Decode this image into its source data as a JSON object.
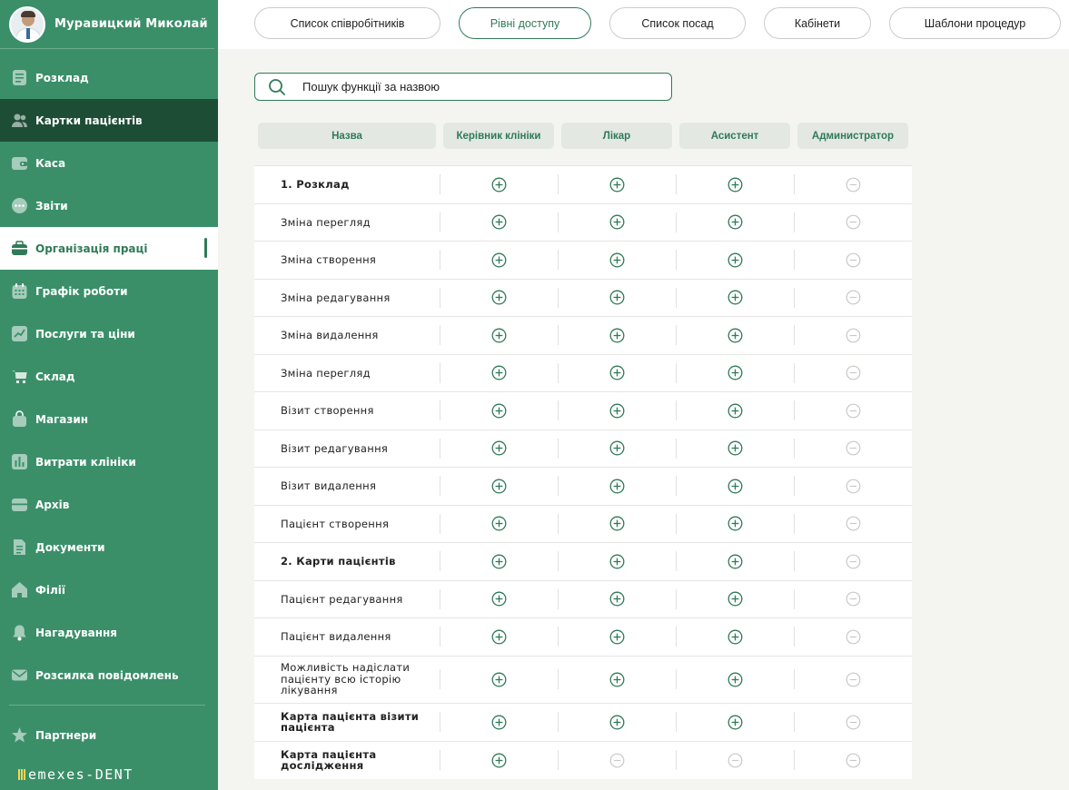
{
  "user": {
    "name": "Муравицкий Миколай"
  },
  "sidebar": {
    "items": [
      {
        "label": "Розклад",
        "icon": "schedule-icon",
        "state": "normal"
      },
      {
        "label": "Картки пацієнтів",
        "icon": "patients-icon",
        "state": "dark"
      },
      {
        "label": "Каса",
        "icon": "wallet-icon",
        "state": "normal"
      },
      {
        "label": "Звіти",
        "icon": "reports-icon",
        "state": "normal"
      },
      {
        "label": "Організація праці",
        "icon": "briefcase-icon",
        "state": "active"
      },
      {
        "label": "Графік роботи",
        "icon": "calendar-icon",
        "state": "normal"
      },
      {
        "label": "Послуги та ціни",
        "icon": "chart-line-icon",
        "state": "normal"
      },
      {
        "label": "Склад",
        "icon": "cart-icon",
        "state": "normal"
      },
      {
        "label": "Магазин",
        "icon": "shop-bag-icon",
        "state": "normal"
      },
      {
        "label": "Витрати клініки",
        "icon": "bar-chart-icon",
        "state": "normal"
      },
      {
        "label": "Архів",
        "icon": "archive-icon",
        "state": "normal"
      },
      {
        "label": "Документи",
        "icon": "document-icon",
        "state": "normal"
      },
      {
        "label": "Філії",
        "icon": "home-icon",
        "state": "normal"
      },
      {
        "label": "Нагадування",
        "icon": "bell-icon",
        "state": "normal"
      },
      {
        "label": "Розсилка повідомлень",
        "icon": "mail-icon",
        "state": "normal"
      }
    ],
    "partners": {
      "label": "Партнери",
      "icon": "star-icon"
    },
    "brand": "emexes-DENT"
  },
  "tabs": [
    {
      "label": "Список співробітників",
      "active": false
    },
    {
      "label": "Рівні доступу",
      "active": true
    },
    {
      "label": "Список посад",
      "active": false
    },
    {
      "label": "Кабінети",
      "active": false
    },
    {
      "label": "Шаблони процедур",
      "active": false
    }
  ],
  "search": {
    "placeholder": "Пошук функції за назвою",
    "value": ""
  },
  "table": {
    "columns": [
      "Назва",
      "Керівник клініки",
      "Лікар",
      "Асистент",
      "Администратор"
    ],
    "rows": [
      {
        "name": "1. Розклад",
        "bold": true,
        "perms": [
          true,
          true,
          true,
          false
        ]
      },
      {
        "name": "Зміна перегляд",
        "bold": false,
        "perms": [
          true,
          true,
          true,
          false
        ]
      },
      {
        "name": "Зміна створення",
        "bold": false,
        "perms": [
          true,
          true,
          true,
          false
        ]
      },
      {
        "name": "Зміна редагування",
        "bold": false,
        "perms": [
          true,
          true,
          true,
          false
        ]
      },
      {
        "name": "Зміна видалення",
        "bold": false,
        "perms": [
          true,
          true,
          true,
          false
        ]
      },
      {
        "name": "Зміна перегляд",
        "bold": false,
        "perms": [
          true,
          true,
          true,
          false
        ]
      },
      {
        "name": "Візит створення",
        "bold": false,
        "perms": [
          true,
          true,
          true,
          false
        ]
      },
      {
        "name": "Візит редагування",
        "bold": false,
        "perms": [
          true,
          true,
          true,
          false
        ]
      },
      {
        "name": "Візит видалення",
        "bold": false,
        "perms": [
          true,
          true,
          true,
          false
        ]
      },
      {
        "name": "Пацієнт створення",
        "bold": false,
        "perms": [
          true,
          true,
          true,
          false
        ]
      },
      {
        "name": "2. Карти пацієнтів",
        "bold": true,
        "perms": [
          true,
          true,
          true,
          false
        ]
      },
      {
        "name": "Пацієнт редагування",
        "bold": false,
        "perms": [
          true,
          true,
          true,
          false
        ]
      },
      {
        "name": "Пацієнт видалення",
        "bold": false,
        "perms": [
          true,
          true,
          true,
          false
        ]
      },
      {
        "name": "Можливість надіслати пацієнту всю історію лікування",
        "bold": false,
        "perms": [
          true,
          true,
          true,
          false
        ]
      },
      {
        "name": "Карта пацієнта візити пацієнта",
        "bold": true,
        "perms": [
          true,
          true,
          true,
          false
        ]
      },
      {
        "name": "Карта пацієнта дослідження",
        "bold": true,
        "perms": [
          true,
          false,
          false,
          false
        ]
      }
    ]
  },
  "colors": {
    "sidebar": "#3a8f69",
    "sidebar_dark": "#1e4d36",
    "accent": "#2f7a57",
    "header_cell": "#e3e8e3",
    "disabled": "#c7cac6"
  }
}
